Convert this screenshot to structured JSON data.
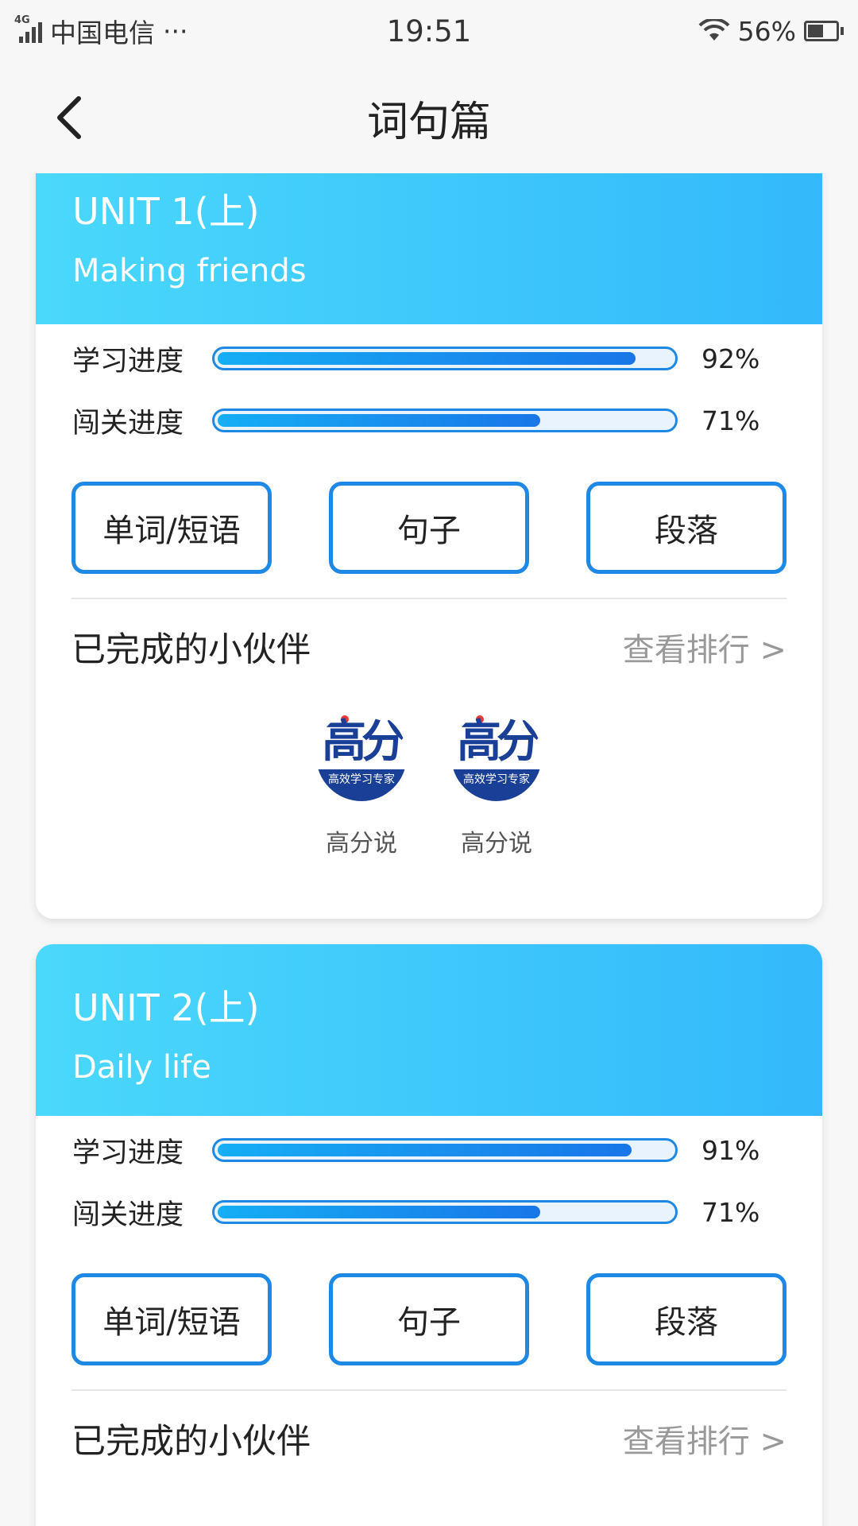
{
  "status_bar": {
    "network_type": "4G",
    "carrier": "中国电信",
    "more": "···",
    "time": "19:51",
    "battery": "56%",
    "battery_level": 56
  },
  "nav": {
    "title": "词句篇"
  },
  "units": [
    {
      "title": "UNIT 1(上)",
      "subtitle": "Making friends",
      "study_label": "学习进度",
      "study_value": "92%",
      "study_fraction": 0.92,
      "pass_label": "闯关进度",
      "pass_value": "71%",
      "pass_fraction": 0.71,
      "buttons": [
        "单词/短语",
        "句子",
        "段落"
      ],
      "partners_title": "已完成的小伙伴",
      "ranking_link": "查看排行 >",
      "partners": [
        {
          "logo": "高分",
          "logo_band": "高效学习专家",
          "name": "高分说"
        },
        {
          "logo": "高分",
          "logo_band": "高效学习专家",
          "name": "高分说"
        }
      ]
    },
    {
      "title": "UNIT 2(上)",
      "subtitle": "Daily life",
      "study_label": "学习进度",
      "study_value": "91%",
      "study_fraction": 0.91,
      "pass_label": "闯关进度",
      "pass_value": "71%",
      "pass_fraction": 0.71,
      "buttons": [
        "单词/短语",
        "句子",
        "段落"
      ],
      "partners_title": "已完成的小伙伴",
      "ranking_link": "查看排行 >",
      "partners": []
    }
  ]
}
